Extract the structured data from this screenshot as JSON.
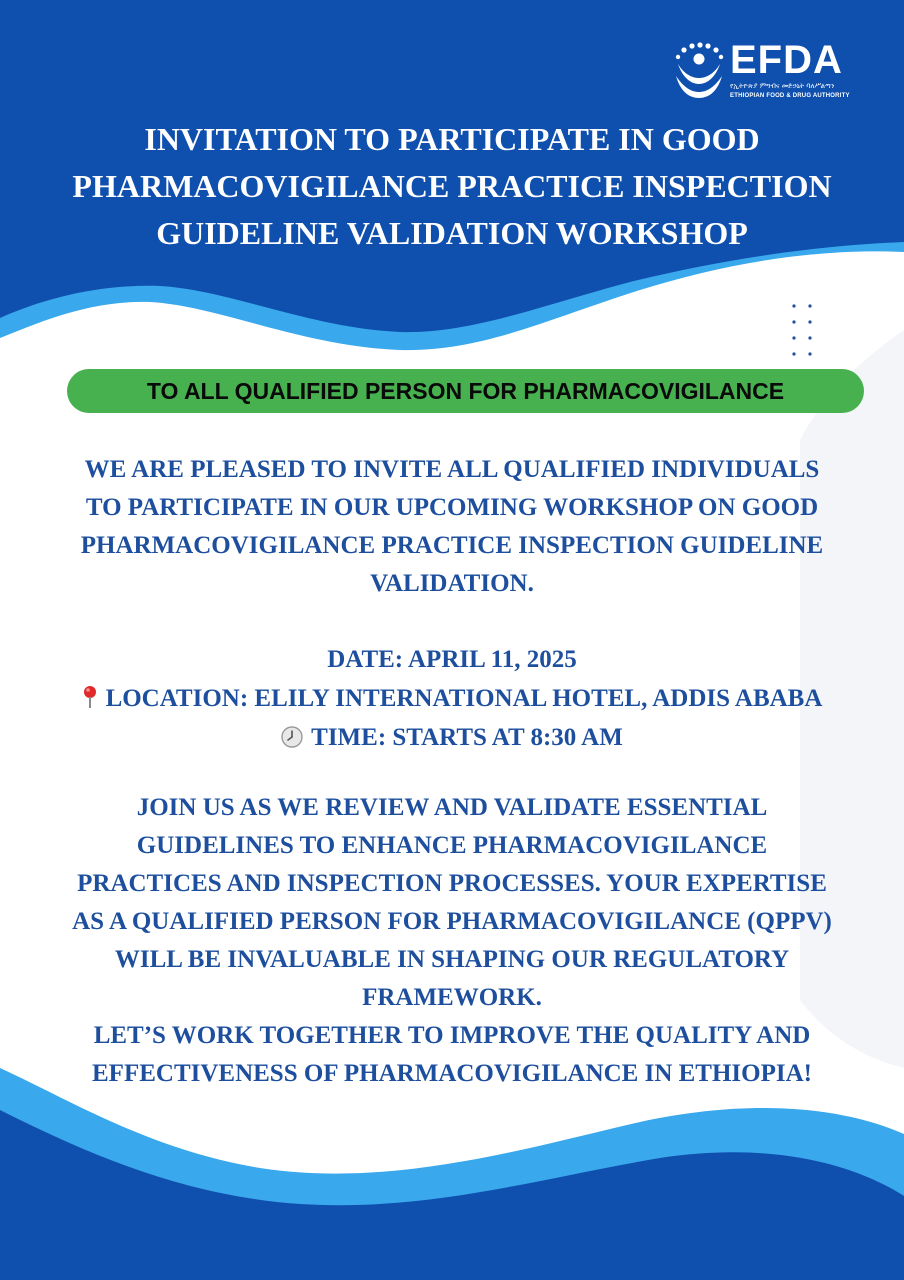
{
  "organization": {
    "abbreviation": "EFDA",
    "name_amharic": "የኢትዮጵያ ምግብና መድኃኒት ባለሥልጣን",
    "name_english": "ETHIOPIAN FOOD & DRUG AUTHORITY",
    "logo_icon": "efda-emblem-icon"
  },
  "title": {
    "lines": [
      "INVITATION TO PARTICIPATE IN GOOD",
      "PHARMACOVIGILANCE PRACTICE INSPECTION",
      "GUIDELINE VALIDATION WORKSHOP"
    ]
  },
  "audience_banner": "TO ALL QUALIFIED PERSON FOR PHARMACOVIGILANCE",
  "intro": {
    "lines": [
      "WE ARE PLEASED TO INVITE ALL QUALIFIED INDIVIDUALS",
      "TO PARTICIPATE IN OUR UPCOMING WORKSHOP ON GOOD",
      "PHARMACOVIGILANCE PRACTICE INSPECTION GUIDELINE",
      "VALIDATION."
    ]
  },
  "details": {
    "date": "DATE: APRIL 11, 2025",
    "location": "LOCATION: ELILY INTERNATIONAL HOTEL, ADDIS ABABA",
    "location_icon": "pushpin-icon",
    "time": "TIME: STARTS AT 8:30 AM",
    "time_icon": "clock-icon"
  },
  "closing": {
    "lines": [
      "JOIN US AS WE REVIEW AND VALIDATE ESSENTIAL",
      "GUIDELINES TO ENHANCE PHARMACOVIGILANCE",
      "PRACTICES AND INSPECTION PROCESSES. YOUR EXPERTISE",
      "AS A QUALIFIED PERSON FOR PHARMACOVIGILANCE (QPPV)",
      "WILL BE INVALUABLE IN SHAPING OUR REGULATORY",
      "FRAMEWORK.",
      "LET’S WORK TOGETHER TO IMPROVE THE QUALITY AND",
      "EFFECTIVENESS OF PHARMACOVIGILANCE IN ETHIOPIA!"
    ]
  },
  "colors": {
    "primary_blue": "#0f4fae",
    "light_blue": "#3aa8ec",
    "banner_green": "#47b14f",
    "body_text": "#1d4f9e",
    "title_text": "#ffffff"
  }
}
